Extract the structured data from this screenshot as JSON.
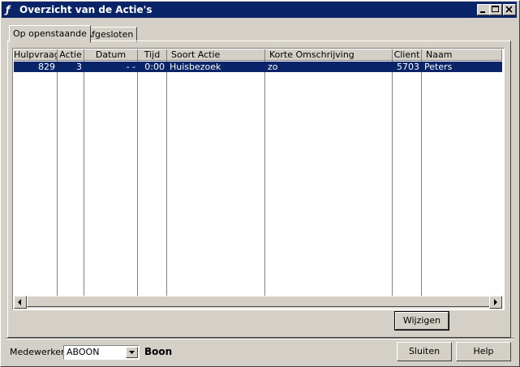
{
  "window": {
    "title": "Overzicht van de Actie's"
  },
  "tabs": [
    {
      "label": "Op openstaande"
    },
    {
      "label": "Afgesloten"
    }
  ],
  "table": {
    "columns": [
      "Hulpvraag",
      "Actie",
      "Datum",
      "Tijd",
      "Soort Actie",
      "Korte Omschrijving",
      "Client",
      "Naam"
    ],
    "rows": [
      {
        "hulpvraag": "829",
        "actie": "3",
        "datum": "- -",
        "tijd": "0:00",
        "soort_actie": "Huisbezoek",
        "korte_omschrijving": "zo",
        "client": "5703",
        "naam": "Peters"
      }
    ]
  },
  "buttons": {
    "wijzigen": "Wijzigen",
    "sluiten": "Sluiten",
    "help": "Help"
  },
  "footer": {
    "medewerker_label": "Medewerker:",
    "medewerker_value": "ABOON",
    "medewerker_name": "Boon"
  },
  "colors": {
    "titlebar": "#0a246a",
    "face": "#d4d0c8",
    "selection": "#0a246a"
  }
}
